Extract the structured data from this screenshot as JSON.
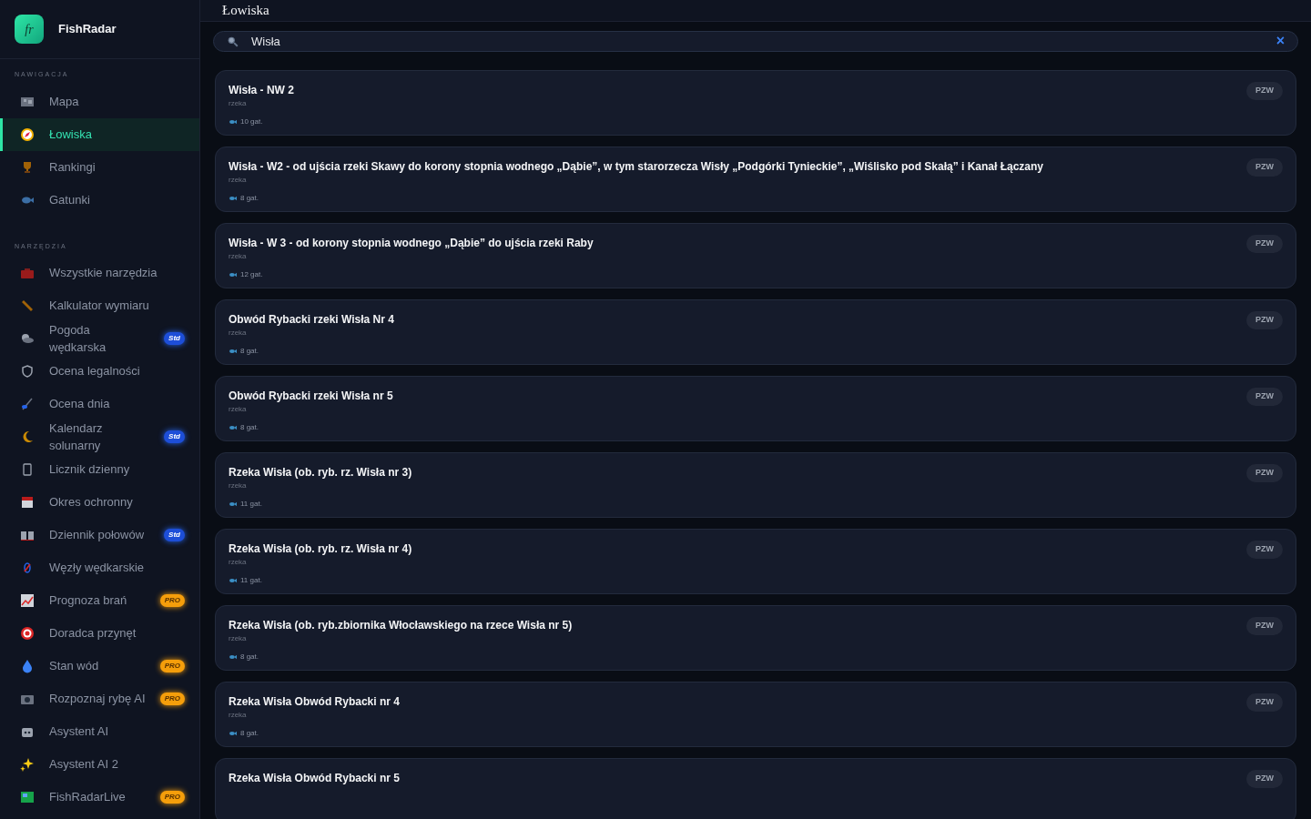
{
  "brand": {
    "logo": "fr",
    "name": "FishRadar"
  },
  "sidebar": {
    "sections": [
      {
        "heading": "NAWIGACJA",
        "items": [
          {
            "label": "Mapa",
            "selected": false
          },
          {
            "label": "Łowiska",
            "selected": true
          },
          {
            "label": "Rankingi",
            "selected": false
          },
          {
            "label": "Gatunki",
            "selected": false
          }
        ]
      },
      {
        "heading": "NARZĘDZIA",
        "items": [
          {
            "label": "Wszystkie narzędzia",
            "selected": false
          },
          {
            "label": "Kalkulator wymiaru",
            "selected": false
          },
          {
            "label": "Pogoda wędkarska",
            "selected": false,
            "badge": {
              "text": "Std",
              "kind": "std"
            }
          },
          {
            "label": "Ocena legalności",
            "selected": false
          },
          {
            "label": "Ocena dnia",
            "selected": false
          },
          {
            "label": "Kalendarz solunarny",
            "selected": false,
            "badge": {
              "text": "Std",
              "kind": "std"
            }
          },
          {
            "label": "Licznik dzienny",
            "selected": false
          },
          {
            "label": "Okres ochronny",
            "selected": false
          },
          {
            "label": "Dziennik połowów",
            "selected": false,
            "badge": {
              "text": "Std",
              "kind": "std"
            }
          },
          {
            "label": "Węzły wędkarskie",
            "selected": false
          },
          {
            "label": "Prognoza brań",
            "selected": false,
            "badge": {
              "text": "PRO",
              "kind": "pro"
            }
          },
          {
            "label": "Doradca przynęt",
            "selected": false
          },
          {
            "label": "Stan wód",
            "selected": false,
            "badge": {
              "text": "PRO",
              "kind": "pro"
            }
          },
          {
            "label": "Rozpoznaj rybę AI",
            "selected": false,
            "badge": {
              "text": "PRO",
              "kind": "pro"
            }
          },
          {
            "label": "Asystent AI",
            "selected": false
          },
          {
            "label": "Asystent AI 2",
            "selected": false
          },
          {
            "label": "FishRadarLive",
            "selected": false,
            "badge": {
              "text": "PRO",
              "kind": "pro"
            }
          }
        ]
      }
    ]
  },
  "header": {
    "title": "Łowiska"
  },
  "search": {
    "value": "Wisła",
    "clear": "×"
  },
  "results": [
    {
      "name": "Wisła - NW 2",
      "type": "rzeka",
      "species": "10 gat.",
      "badge": "PZW"
    },
    {
      "name": "Wisła - W2 - od ujścia rzeki Skawy do korony stopnia wodnego „Dąbie”, w tym starorzecza Wisły „Podgórki Tynieckie”, „Wiślisko pod Skałą” i Kanał Łączany",
      "type": "rzeka",
      "species": "8 gat.",
      "badge": "PZW"
    },
    {
      "name": "Wisła - W 3 - od korony stopnia wodnego „Dąbie” do ujścia rzeki Raby",
      "type": "rzeka",
      "species": "12 gat.",
      "badge": "PZW"
    },
    {
      "name": "Obwód Rybacki rzeki Wisła Nr 4",
      "type": "rzeka",
      "species": "8 gat.",
      "badge": "PZW"
    },
    {
      "name": "Obwód Rybacki rzeki Wisła nr 5",
      "type": "rzeka",
      "species": "8 gat.",
      "badge": "PZW"
    },
    {
      "name": "Rzeka Wisła (ob. ryb. rz. Wisła nr 3)",
      "type": "rzeka",
      "species": "11 gat.",
      "badge": "PZW"
    },
    {
      "name": "Rzeka Wisła (ob. ryb. rz. Wisła nr 4)",
      "type": "rzeka",
      "species": "11 gat.",
      "badge": "PZW"
    },
    {
      "name": "Rzeka Wisła (ob. ryb.zbiornika Włocławskiego na rzece Wisła nr 5)",
      "type": "rzeka",
      "species": "8 gat.",
      "badge": "PZW"
    },
    {
      "name": "Rzeka Wisła Obwód Rybacki nr 4",
      "type": "rzeka",
      "species": "8 gat.",
      "badge": "PZW"
    },
    {
      "name": "Rzeka Wisła Obwód Rybacki nr 5",
      "badge": "PZW"
    }
  ]
}
